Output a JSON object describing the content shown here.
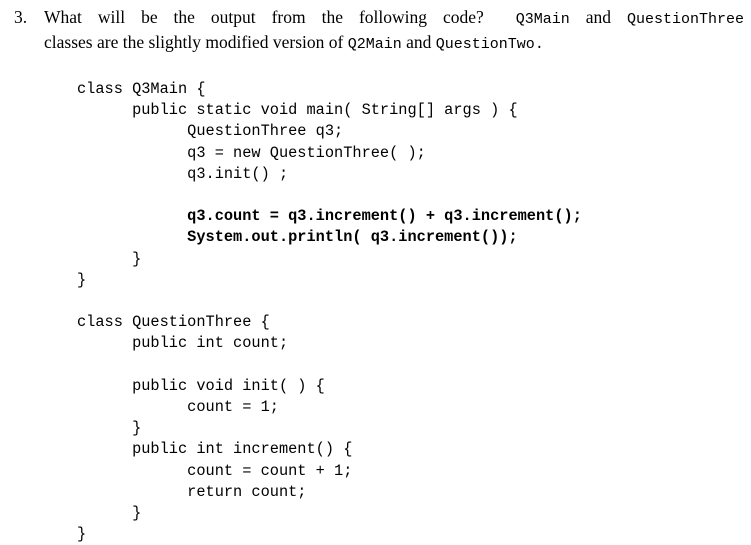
{
  "question": {
    "number": "3.",
    "line1_part1": "What will be the output from the following code?",
    "line1_code1": "Q3Main",
    "line1_part2": "and",
    "line1_code2": "QuestionThree",
    "line2_part1": "classes are the slightly modified version of",
    "line2_code1": "Q2Main",
    "line2_part2": "and",
    "line2_code2": "QuestionTwo."
  },
  "code": {
    "lines": [
      {
        "text": "class Q3Main {",
        "bold": false
      },
      {
        "text": "      public static void main( String[] args ) {",
        "bold": false
      },
      {
        "text": "            QuestionThree q3;",
        "bold": false
      },
      {
        "text": "            q3 = new QuestionThree( );",
        "bold": false
      },
      {
        "text": "            q3.init() ;",
        "bold": false
      },
      {
        "text": "",
        "bold": false
      },
      {
        "text": "            q3.count = q3.increment() + q3.increment();",
        "bold": true
      },
      {
        "text": "            System.out.println( q3.increment());",
        "bold": true
      },
      {
        "text": "      }",
        "bold": false
      },
      {
        "text": "}",
        "bold": false
      },
      {
        "text": "",
        "bold": false
      },
      {
        "text": "class QuestionThree {",
        "bold": false
      },
      {
        "text": "      public int count;",
        "bold": false
      },
      {
        "text": "",
        "bold": false
      },
      {
        "text": "      public void init( ) {",
        "bold": false
      },
      {
        "text": "            count = 1;",
        "bold": false
      },
      {
        "text": "      }",
        "bold": false
      },
      {
        "text": "      public int increment() {",
        "bold": false
      },
      {
        "text": "            count = count + 1;",
        "bold": false
      },
      {
        "text": "            return count;",
        "bold": false
      },
      {
        "text": "      }",
        "bold": false
      },
      {
        "text": "}",
        "bold": false
      }
    ]
  },
  "colors": {
    "background": "#ffffff",
    "text": "#000000"
  }
}
